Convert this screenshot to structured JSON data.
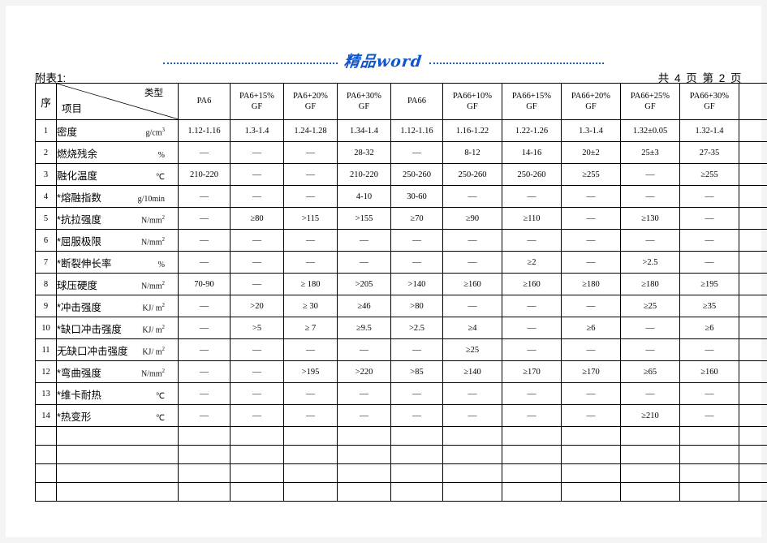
{
  "watermark": {
    "text": "精品word"
  },
  "caption": {
    "left": "附表1:",
    "right": "共 4 页    第 2 页"
  },
  "table": {
    "corner": {
      "type_label": "类型",
      "item_label": "项目"
    },
    "seq_header": "序",
    "columns": [
      "PA6",
      "PA6+15%\nGF",
      "PA6+20%\nGF",
      "PA6+30%\nGF",
      "PA66",
      "PA66+10%\nGF",
      "PA66+15%\nGF",
      "PA66+20%\nGF",
      "PA66+25%\nGF",
      "PA66+30%\nGF",
      ""
    ],
    "columns_line1": [
      "PA6",
      "PA6+15%",
      "PA6+20%",
      "PA6+30%",
      "PA66",
      "PA66+10%",
      "PA66+15%",
      "PA66+20%",
      "PA66+25%",
      "PA66+30%",
      ""
    ],
    "columns_line2": [
      "",
      "GF",
      "GF",
      "GF",
      "",
      "GF",
      "GF",
      "GF",
      "GF",
      "GF",
      ""
    ],
    "rows": [
      {
        "seq": "1",
        "name": "密度",
        "unit": "g/cm³",
        "values": [
          "1.12-1.16",
          "1.3-1.4",
          "1.24-1.28",
          "1.34-1.4",
          "1.12-1.16",
          "1.16-1.22",
          "1.22-1.26",
          "1.3-1.4",
          "1.32±0.05",
          "1.32-1.4",
          ""
        ]
      },
      {
        "seq": "2",
        "name": "燃烧残余",
        "unit": "%",
        "values": [
          "—",
          "—",
          "—",
          "28-32",
          "—",
          "8-12",
          "14-16",
          "20±2",
          "25±3",
          "27-35",
          ""
        ]
      },
      {
        "seq": "3",
        "name": "融化温度",
        "unit": "℃",
        "values": [
          "210-220",
          "—",
          "—",
          "210-220",
          "250-260",
          "250-260",
          "250-260",
          "≥255",
          "—",
          "≥255",
          ""
        ]
      },
      {
        "seq": "4",
        "name": "*熔融指数",
        "unit": "g/10min",
        "values": [
          "—",
          "—",
          "—",
          "4-10",
          "30-60",
          "—",
          "—",
          "—",
          "—",
          "—",
          ""
        ]
      },
      {
        "seq": "5",
        "name": "*抗拉强度",
        "unit": "N/mm²",
        "values": [
          "—",
          "≥80",
          ">115",
          ">155",
          "≥70",
          "≥90",
          "≥110",
          "—",
          "≥130",
          "—",
          ""
        ]
      },
      {
        "seq": "6",
        "name": "*屈服极限",
        "unit": "N/mm²",
        "values": [
          "—",
          "—",
          "—",
          "—",
          "—",
          "—",
          "—",
          "—",
          "—",
          "—",
          ""
        ]
      },
      {
        "seq": "7",
        "name": "*断裂伸长率",
        "unit": "%",
        "values": [
          "—",
          "—",
          "—",
          "—",
          "—",
          "—",
          "≥2",
          "—",
          ">2.5",
          "—",
          ""
        ]
      },
      {
        "seq": "8",
        "name": "球压硬度",
        "unit": "N/mm²",
        "values": [
          "70-90",
          "—",
          "≥ 180",
          ">205",
          ">140",
          "≥160",
          "≥160",
          "≥180",
          "≥180",
          "≥195",
          ""
        ]
      },
      {
        "seq": "9",
        "name": "*冲击强度",
        "unit": "KJ/ m²",
        "values": [
          "—",
          ">20",
          "≥ 30",
          "≥46",
          ">80",
          "—",
          "—",
          "—",
          "≥25",
          "≥35",
          ""
        ]
      },
      {
        "seq": "10",
        "name": "*缺口冲击强度",
        "unit": "KJ/ m²",
        "values": [
          "—",
          ">5",
          "≥ 7",
          "≥9.5",
          ">2.5",
          "≥4",
          "—",
          "≥6",
          "—",
          "≥6",
          ""
        ]
      },
      {
        "seq": "11",
        "name": "无缺口冲击强度",
        "unit": "KJ/ m²",
        "values": [
          "—",
          "—",
          "—",
          "—",
          "—",
          "≥25",
          "—",
          "—",
          "—",
          "—",
          ""
        ]
      },
      {
        "seq": "12",
        "name": "*弯曲强度",
        "unit": "N/mm²",
        "values": [
          "—",
          "—",
          ">195",
          ">220",
          ">85",
          "≥140",
          "≥170",
          "≥170",
          "≥65",
          "≥160",
          ""
        ]
      },
      {
        "seq": "13",
        "name": "*维卡耐热",
        "unit": "℃",
        "values": [
          "—",
          "—",
          "—",
          "—",
          "—",
          "—",
          "—",
          "—",
          "—",
          "—",
          ""
        ]
      },
      {
        "seq": "14",
        "name": "*热变形",
        "unit": "℃",
        "values": [
          "—",
          "—",
          "—",
          "—",
          "—",
          "—",
          "—",
          "—",
          "≥210",
          "—",
          ""
        ]
      }
    ],
    "empty_rows": 4
  }
}
